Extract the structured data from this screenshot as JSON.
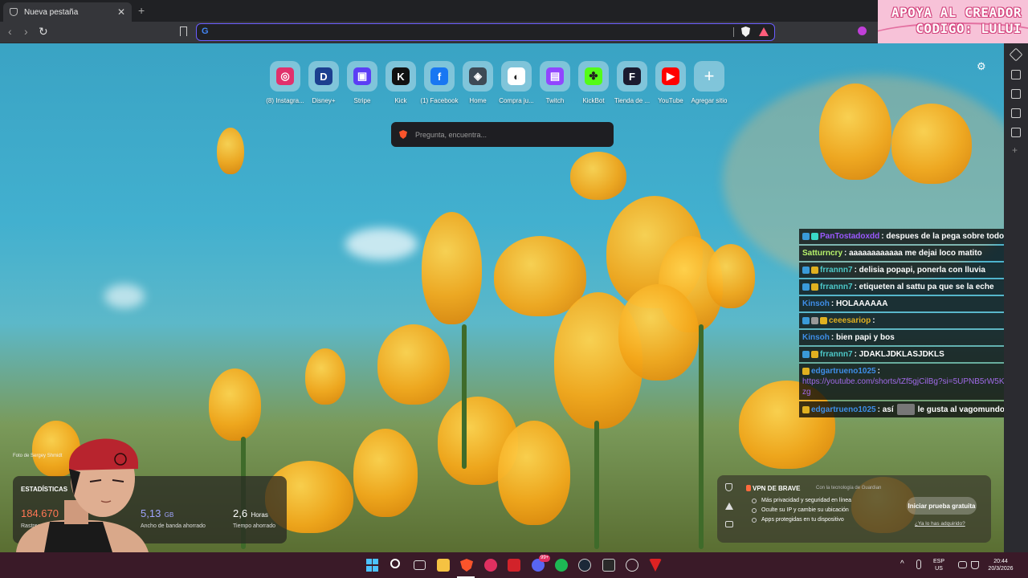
{
  "browser": {
    "tab_title": "Nueva pestaña",
    "new_tab_label": "+",
    "address_value": ""
  },
  "overlay": {
    "banner_line1": "APOYA AL CREADOR",
    "banner_line2": "CODIGO: LULUI"
  },
  "top_sites": [
    {
      "label": "(8) Instagra...",
      "icon": "instagram-icon",
      "color": "#e1306c",
      "glyph": "◎"
    },
    {
      "label": "Disney+",
      "icon": "disney-icon",
      "color": "#1c3f8f",
      "glyph": "D"
    },
    {
      "label": "Stripe",
      "icon": "stripe-icon",
      "color": "#5b3ef5",
      "glyph": "▣"
    },
    {
      "label": "Kick",
      "icon": "kick-icon",
      "color": "#111111",
      "glyph": "K"
    },
    {
      "label": "(1) Facebook",
      "icon": "facebook-icon",
      "color": "#1877f2",
      "glyph": "f"
    },
    {
      "label": "Home",
      "icon": "home-icon",
      "color": "#3d4a55",
      "glyph": "◈"
    },
    {
      "label": "Compra ju...",
      "icon": "store-icon",
      "color": "#ffffff",
      "glyph": "◐"
    },
    {
      "label": "Twitch",
      "icon": "twitch-icon",
      "color": "#9146ff",
      "glyph": "▤"
    },
    {
      "label": "KickBot",
      "icon": "kickbot-icon",
      "color": "#53fc18",
      "glyph": "✤"
    },
    {
      "label": "Tienda de ...",
      "icon": "tienda-icon",
      "color": "#1b1b2f",
      "glyph": "F"
    },
    {
      "label": "YouTube",
      "icon": "youtube-icon",
      "color": "#ff0000",
      "glyph": "▶"
    },
    {
      "label": "Agregar sitio",
      "icon": "add-site-icon",
      "color": "transparent",
      "glyph": "+"
    }
  ],
  "search": {
    "placeholder": "Pregunta, encuentra..."
  },
  "chat": [
    {
      "user": "PanTostadoxdd",
      "user_color": "#9b59ff",
      "badges": [
        "#3a9ad9",
        "#3ad9c8"
      ],
      "message": ": despues de la pega sobre todo"
    },
    {
      "user": "Satturncry",
      "user_color": "#b7f26b",
      "badges": [],
      "message": ": aaaaaaaaaaaa me dejai loco matito"
    },
    {
      "user": "frrannn7",
      "user_color": "#4dc9c9",
      "badges": [
        "#3a9ad9",
        "#e0b020"
      ],
      "message": ": delisia popapi, ponerla con lluvia"
    },
    {
      "user": "frrannn7",
      "user_color": "#4dc9c9",
      "badges": [
        "#3a9ad9",
        "#e0b020"
      ],
      "message": ": etiqueten al sattu pa que se la eche"
    },
    {
      "user": "Kinsoh",
      "user_color": "#3e8ee8",
      "badges": [],
      "message": ": HOLAAAAAA"
    },
    {
      "user": "ceeesariop",
      "user_color": "#e0b020",
      "badges": [
        "#3a9ad9",
        "#999999",
        "#e0b020"
      ],
      "message": ":"
    },
    {
      "user": "Kinsoh",
      "user_color": "#3e8ee8",
      "badges": [],
      "message": ": bien papi y bos"
    },
    {
      "user": "frrannn7",
      "user_color": "#4dc9c9",
      "badges": [
        "#3a9ad9",
        "#e0b020"
      ],
      "message": ": JDAKLJDKLASJDKLS"
    },
    {
      "user": "edgartrueno1025",
      "user_color": "#3e8ee8",
      "badges": [
        "#e0b020"
      ],
      "message": ":",
      "link": "https://youtube.com/shorts/tZf5gjCilBg?si=5UPNB5rW5KveJozg"
    },
    {
      "user": "edgartrueno1025",
      "user_color": "#3e8ee8",
      "badges": [
        "#e0b020"
      ],
      "message": ": así",
      "message2": "le gusta al vagomundo"
    }
  ],
  "stats": {
    "title": "ESTADÍSTICAS",
    "trackers_value": "184.670",
    "trackers_label": "Rastreadores y",
    "bandwidth_value": "5,13",
    "bandwidth_unit": "GB",
    "bandwidth_label": "Ancho de banda ahorrado",
    "time_value": "2,6",
    "time_unit": "Horas",
    "time_label": "Tiempo ahorrado",
    "color_trackers": "#ff7654",
    "color_bandwidth": "#a0a5ff"
  },
  "photo_credit": "Foto de Sergey Shmidt",
  "vpn": {
    "title": "VPN DE BRAVE",
    "powered_by": "Con la tecnología de Guardian",
    "features": [
      "Más privacidad y seguridad en línea",
      "Oculte su IP y cambie su ubicación",
      "Apps protegidas en tu dispositivo"
    ],
    "trial_button": "Iniciar prueba gratuita",
    "already_link": "¿Ya lo has adquirido?"
  },
  "taskbar": {
    "language": "ESP",
    "region": "US",
    "time": "20:44",
    "date": "20/3/2026",
    "badge_count": "99+"
  }
}
